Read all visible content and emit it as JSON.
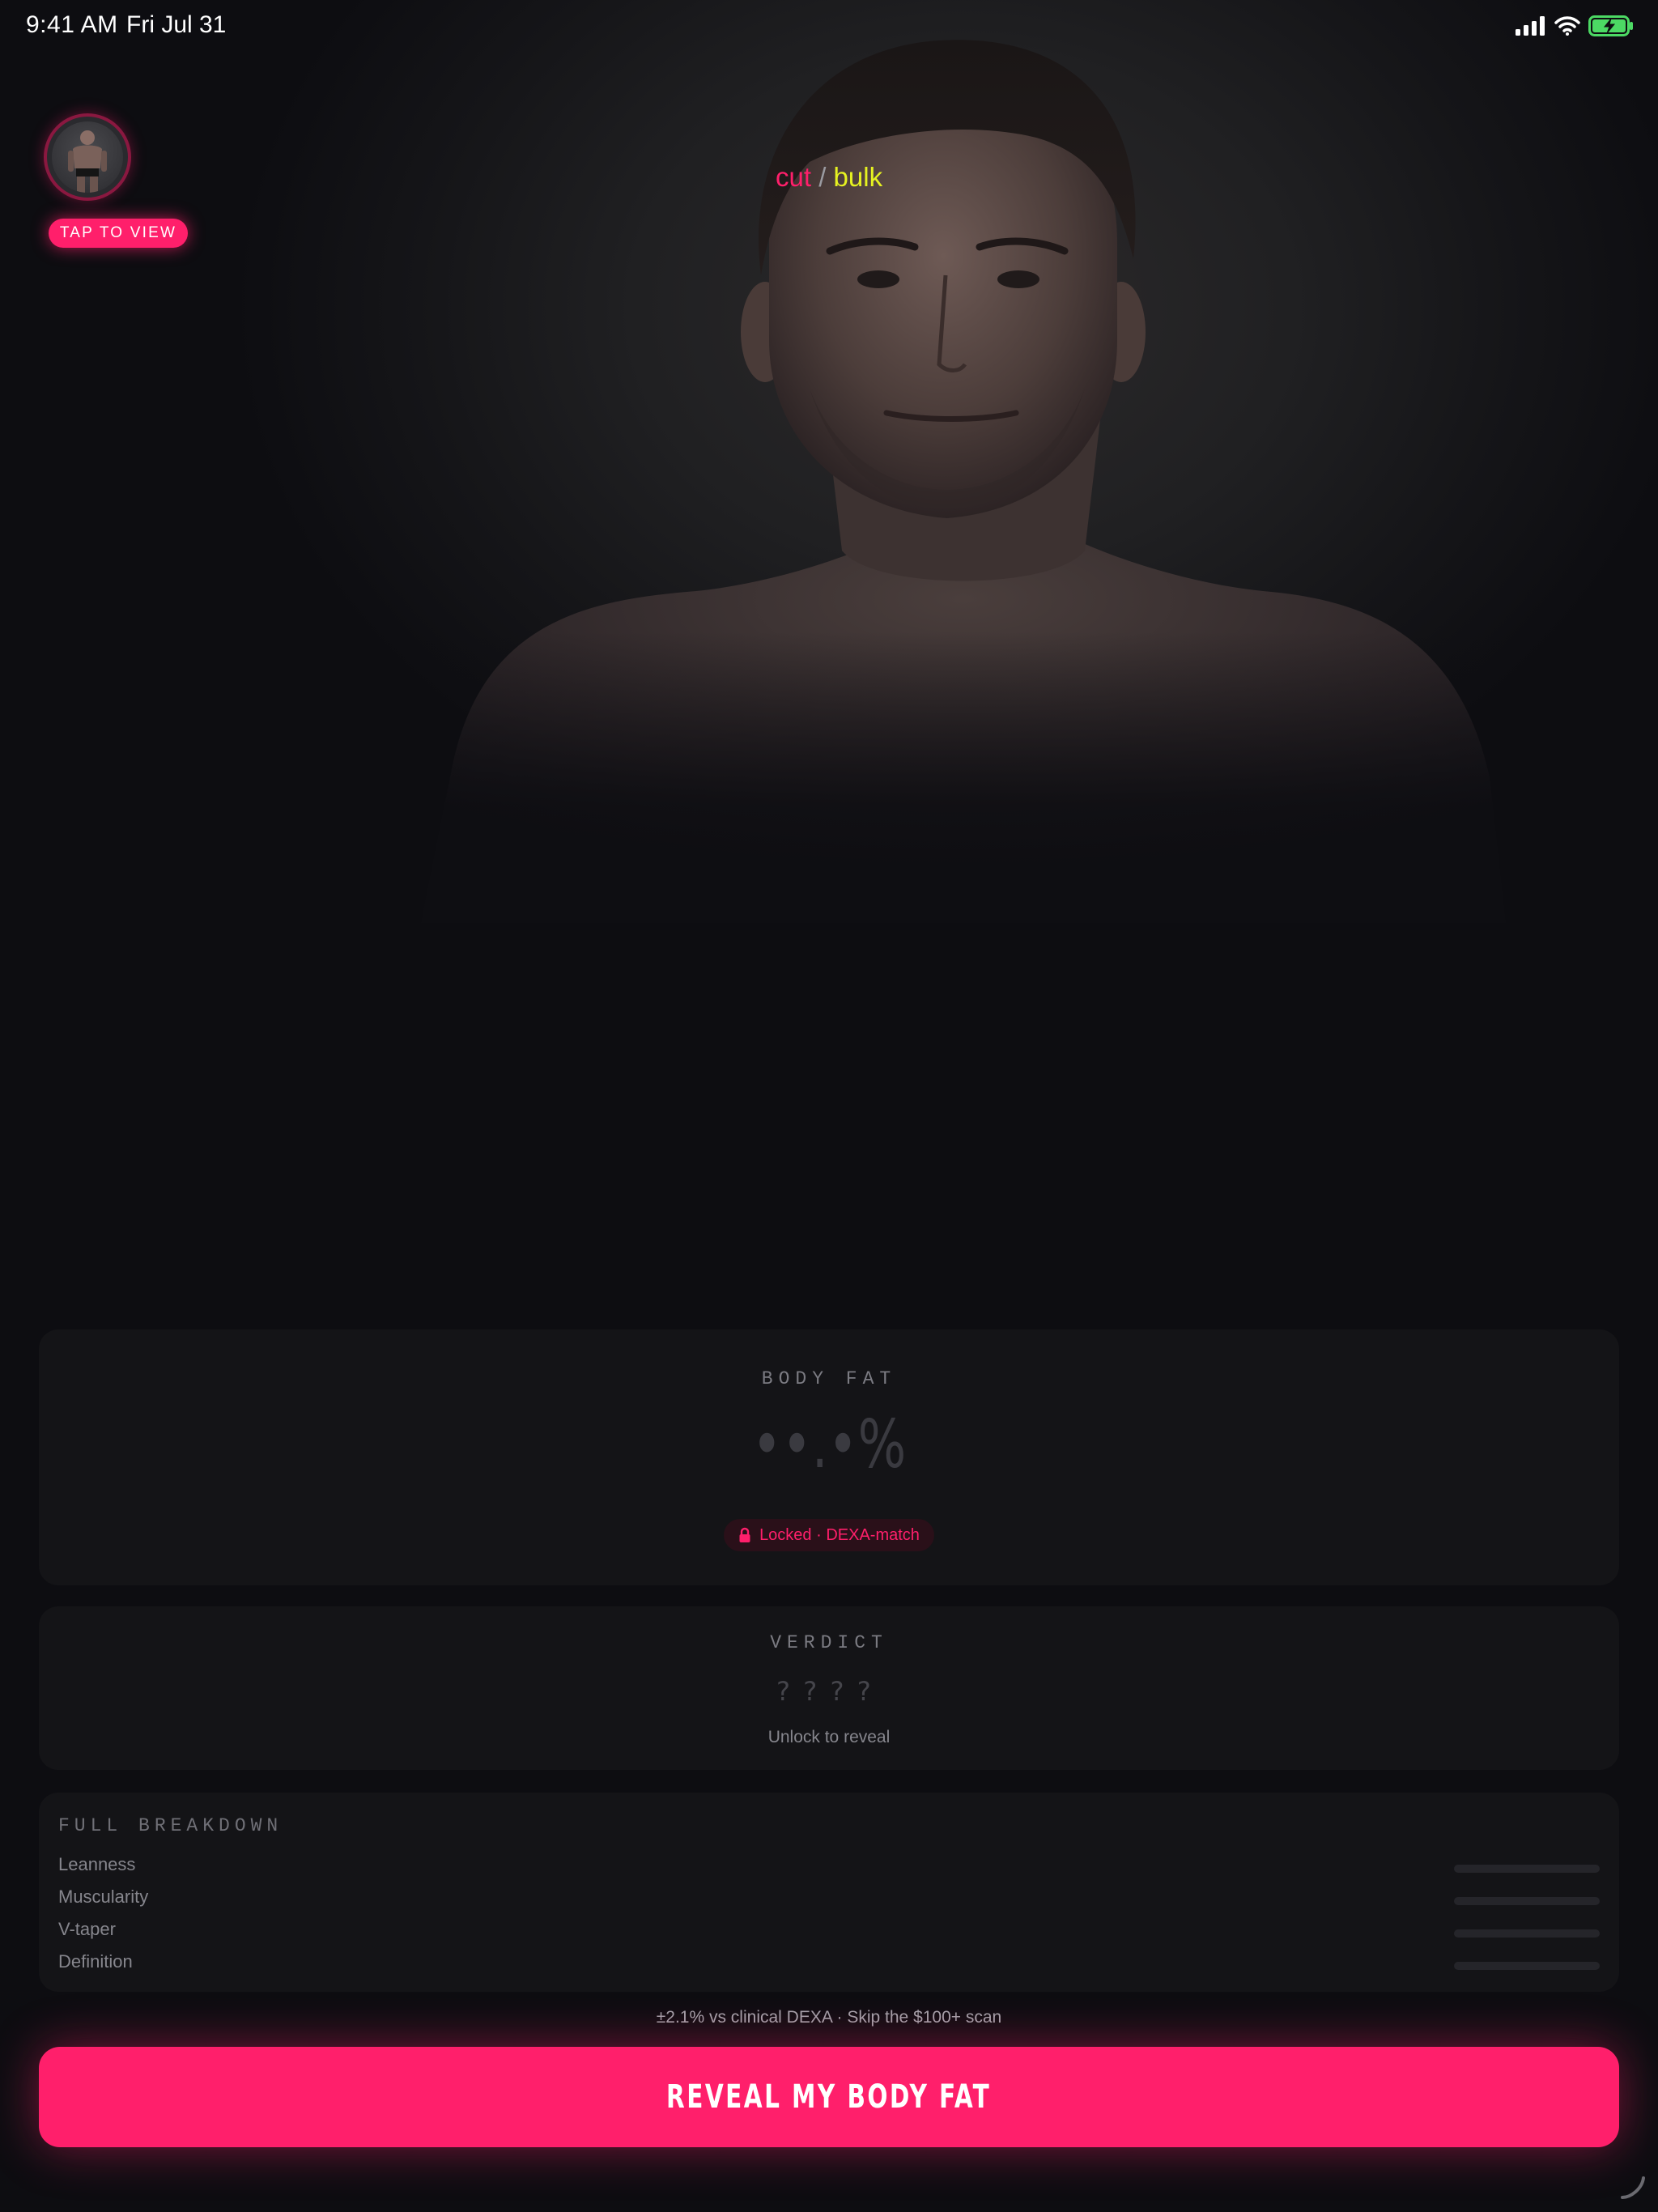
{
  "status_bar": {
    "time": "9:41 AM",
    "date": "Fri Jul 31",
    "battery_color": "#4cd964"
  },
  "thumbnail": {
    "icon": "body-photo-thumbnail",
    "tap_label": "TAP TO VIEW"
  },
  "mode_toggle": {
    "cut": "cut",
    "separator": "/",
    "bulk": "bulk",
    "cut_color": "#ff1f6b",
    "bulk_color": "#e6f221"
  },
  "body_fat": {
    "label": "BODY FAT",
    "value": "••.•%",
    "locked_label": "Locked · DEXA-match",
    "lock_icon": "lock-icon"
  },
  "verdict": {
    "label": "VERDICT",
    "value": "????",
    "sub": "Unlock to reveal"
  },
  "breakdown": {
    "title": "FULL BREAKDOWN",
    "rows": [
      {
        "label": "Leanness"
      },
      {
        "label": "Muscularity"
      },
      {
        "label": "V-taper"
      },
      {
        "label": "Definition"
      }
    ]
  },
  "footnote": "±2.1% vs clinical DEXA · Skip the $100+ scan",
  "cta": {
    "label": "REVEAL MY BODY FAT",
    "color": "#ff1f6b"
  }
}
